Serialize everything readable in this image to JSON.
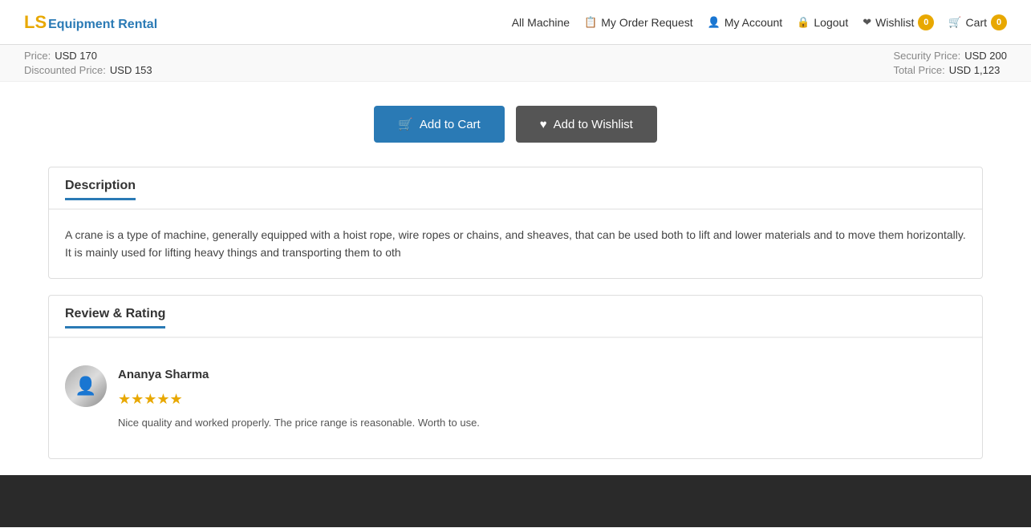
{
  "header": {
    "logo_ls": "LS",
    "logo_company": "Equipment Rental",
    "nav": {
      "all_machine": "All Machine",
      "order_request": "My Order Request",
      "my_account": "My Account",
      "logout": "Logout",
      "wishlist": "Wishlist",
      "wishlist_count": "0",
      "cart": "Cart",
      "cart_count": "0"
    }
  },
  "product_strip": {
    "left": {
      "price_label": "Price:",
      "price_value": "USD 170",
      "discount_label": "Discounted Price:",
      "discount_value": "USD 153"
    },
    "right": {
      "security_label": "Security Price:",
      "security_value": "USD 200",
      "total_label": "Total Price:",
      "total_value": "USD 1,123"
    }
  },
  "buttons": {
    "add_to_cart": "Add to Cart",
    "add_to_wishlist": "Add to Wishlist"
  },
  "description": {
    "title": "Description",
    "body": "A crane is a type of machine, generally equipped with a hoist rope, wire ropes or chains, and sheaves, that can be used both to lift and lower materials and to move them horizontally. It is mainly used for lifting heavy things and transporting them to oth"
  },
  "review": {
    "title": "Review & Rating",
    "reviewer_name": "Ananya Sharma",
    "stars": 5,
    "review_text": "Nice quality and worked properly. The price range is reasonable. Worth to use."
  },
  "icons": {
    "cart_icon": "🛒",
    "heart_icon": "♥",
    "order_icon": "📋",
    "account_icon": "👤",
    "lock_icon": "🔒",
    "wishlist_icon": "❤",
    "star_filled": "★",
    "star_empty": "☆"
  }
}
